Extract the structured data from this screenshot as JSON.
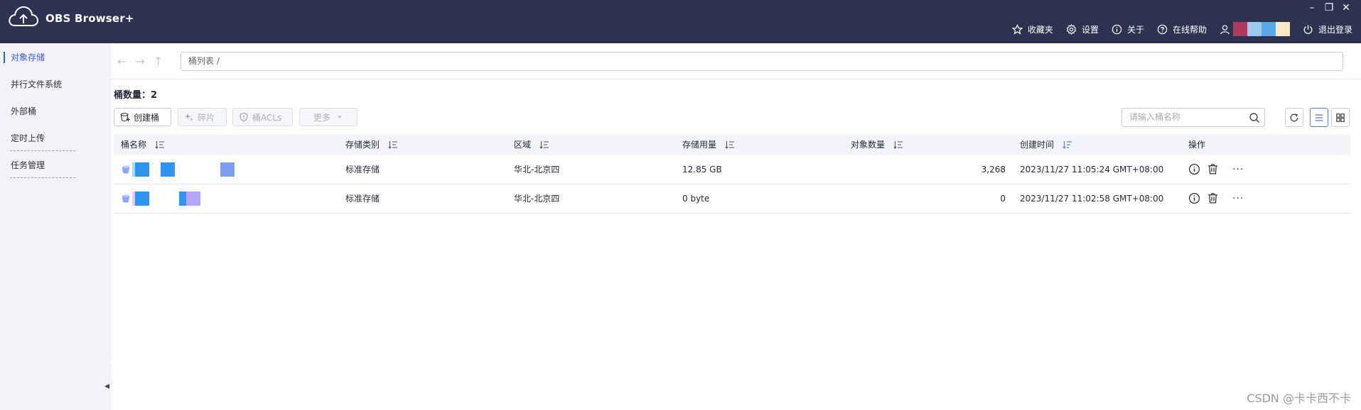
{
  "app": {
    "title": "OBS Browser+"
  },
  "window_controls": {
    "minimize": "–",
    "restore": "❐",
    "close": "✕"
  },
  "header": {
    "actions": [
      {
        "label": "收藏夹",
        "icon": "star-icon"
      },
      {
        "label": "设置",
        "icon": "gear-icon"
      },
      {
        "label": "关于",
        "icon": "info-icon"
      },
      {
        "label": "在线帮助",
        "icon": "help-icon"
      }
    ],
    "user_icon": "user-icon",
    "logout_label": "退出登录"
  },
  "sidebar": {
    "items": [
      {
        "label": "对象存储",
        "active": true
      },
      {
        "label": "并行文件系统",
        "active": false
      },
      {
        "label": "外部桶",
        "active": false
      },
      {
        "label": "定时上传",
        "active": false
      },
      {
        "label": "任务管理",
        "active": false
      }
    ],
    "collapse_glyph": "◀"
  },
  "nav": {
    "back": "←",
    "forward": "→",
    "up": "↑",
    "path": "桶列表 /"
  },
  "summary": {
    "label": "桶数量：",
    "count": "2"
  },
  "toolbar": {
    "create": "创建桶",
    "fragments": "碎片",
    "acls": "桶ACLs",
    "more": "更多",
    "search_placeholder": "请输入桶名称"
  },
  "table": {
    "headers": {
      "name": "桶名称",
      "storage_class": "存储类别",
      "region": "区域",
      "usage": "存储用量",
      "objects": "对象数量",
      "created": "创建时间",
      "ops": "操作"
    },
    "rows": [
      {
        "storage_class": "标准存储",
        "region": "华北-北京四",
        "usage": "12.85 GB",
        "objects": "3,268",
        "created": "2023/11/27 11:05:24 GMT+08:00"
      },
      {
        "storage_class": "标准存储",
        "region": "华北-北京四",
        "usage": "0 byte",
        "objects": "0",
        "created": "2023/11/27 11:02:58 GMT+08:00"
      }
    ],
    "more_ops": "···"
  },
  "watermark": "CSDN @卡卡西不卡"
}
